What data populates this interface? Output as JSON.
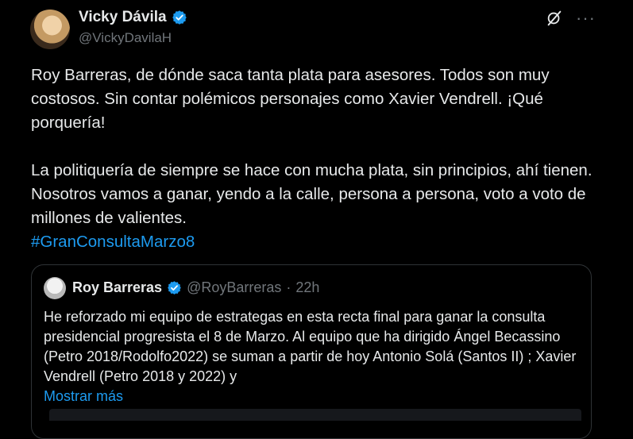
{
  "author": {
    "name": "Vicky Dávila",
    "handle": "@VickyDavilaH"
  },
  "icons": {
    "verified": "verified-badge-icon",
    "grok": "grok-icon",
    "more": "more-icon"
  },
  "colors": {
    "background": "#000000",
    "text": "#e7e9ea",
    "muted": "#71767b",
    "accent": "#1d9bf0",
    "border": "#2f3336"
  },
  "tweet": {
    "paragraph1": "Roy Barreras, de dónde saca tanta plata para asesores. Todos son muy costosos. Sin contar polémicos personajes como Xavier Vendrell. ¡Qué porquería!",
    "paragraph2": "La politiquería de siempre se hace con mucha plata, sin principios, ahí tienen. Nosotros vamos a ganar, yendo a la calle, persona a persona, voto a voto de millones de valientes.",
    "hashtag": "#GranConsultaMarzo8"
  },
  "quote": {
    "name": "Roy Barreras",
    "handle": "@RoyBarreras",
    "separator": "·",
    "time": "22h",
    "text": "He reforzado mi equipo de estrategas en esta  recta final para ganar la consulta presidencial progresista el 8 de Marzo. Al equipo que ha dirigido Ángel Becassino (Petro 2018/Rodolfo2022) se suman a partir de hoy Antonio Solá (Santos II) ; Xavier Vendrell (Petro 2018 y 2022) y",
    "show_more": "Mostrar más"
  }
}
